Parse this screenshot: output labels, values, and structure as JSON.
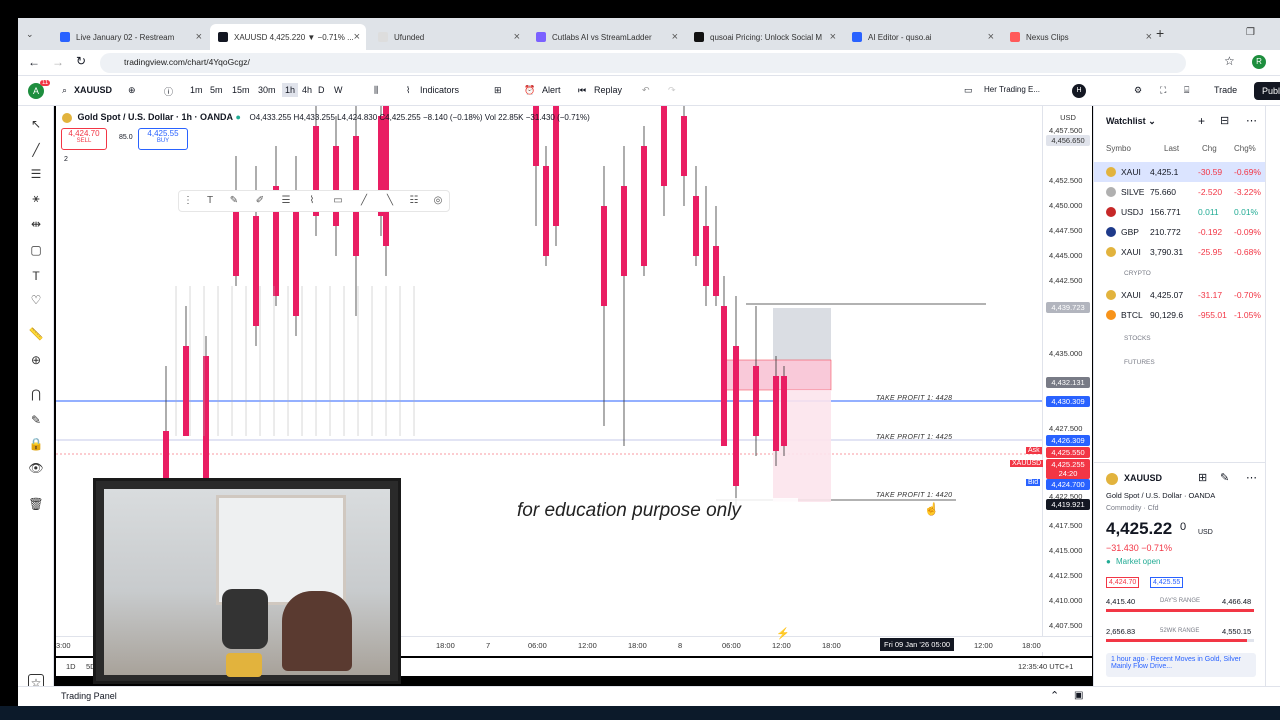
{
  "tabs": [
    {
      "label": "Live January 02 - Restream",
      "fav": "#2962ff",
      "active": false
    },
    {
      "label": "XAUUSD 4,425.220 ▼ −0.71% ...",
      "fav": "#131722",
      "active": true
    },
    {
      "label": "Ufunded",
      "fav": "#ddd",
      "active": false
    },
    {
      "label": "Cutlabs AI vs StreamLadder",
      "fav": "#7b61ff",
      "active": false
    },
    {
      "label": "qusoai Pricing: Unlock Social M",
      "fav": "#111",
      "active": false
    },
    {
      "label": "AI Editor - quso.ai",
      "fav": "#2962ff",
      "active": false
    },
    {
      "label": "Nexus Clips",
      "fav": "#ff5a5a",
      "active": false
    }
  ],
  "url": "tradingview.com/chart/4YqoGcgz/",
  "toolbar": {
    "symbol": "XAUUSD",
    "intervals": [
      "1m",
      "5m",
      "15m",
      "30m",
      "1h",
      "4h",
      "D",
      "W"
    ],
    "indicators": "Indicators",
    "alert": "Alert",
    "replay": "Replay",
    "layout_name": "Her Trading E...",
    "trade": "Trade",
    "publish": "Publi",
    "avatar_letter": "A",
    "badge": "11",
    "h_badge": "H"
  },
  "legend": {
    "title": "Gold Spot / U.S. Dollar · 1h · OANDA",
    "ohlc": "O4,433.255 H4,433.255 L4,424.830 C4,425.255 −8.140 (−0.18%) Vol 22.85K −31.430 (−0.71%)",
    "sell_price": "4,424.70",
    "sell_label": "SELL",
    "spread": "85.0",
    "buy_price": "4,425.55",
    "buy_label": "BUY",
    "count": "2"
  },
  "price_ticks": [
    "4,457.500",
    "4,452.500",
    "4,450.000",
    "4,447.500",
    "4,445.000",
    "4,442.500",
    "4,437.500",
    "4,435.000",
    "4,427.500",
    "4,422.500",
    "4,417.500",
    "4,415.000",
    "4,412.500",
    "4,410.000",
    "4,407.500"
  ],
  "price_labels": [
    {
      "text": "USD",
      "color": "#ffffff",
      "fg": "#333"
    },
    {
      "text": "4,456.650",
      "color": "#e0e3eb",
      "fg": "#333"
    },
    {
      "text": "4,439.723",
      "color": "#b2b5be",
      "fg": "#fff"
    },
    {
      "text": "4,432.131",
      "color": "#787b86",
      "fg": "#fff"
    },
    {
      "text": "4,430.309",
      "color": "#2962ff",
      "fg": "#fff"
    },
    {
      "text": "4,426.309",
      "color": "#2962ff",
      "fg": "#fff"
    },
    {
      "text": "4,425.550",
      "color": "#f23645",
      "fg": "#fff"
    },
    {
      "text": "4,425.255",
      "color": "#f23645",
      "fg": "#fff"
    },
    {
      "text": "24:20",
      "color": "#f23645",
      "fg": "#fff"
    },
    {
      "text": "4,424.700",
      "color": "#2962ff",
      "fg": "#fff"
    },
    {
      "text": "4,419.921",
      "color": "#131722",
      "fg": "#fff"
    }
  ],
  "ask_label": "Ask",
  "sym_label": "XAUUSD",
  "bid_label": "Bid",
  "take_profits": [
    "TAKE PROFIT 1: 4428",
    "TAKE PROFIT 1: 4425",
    "TAKE PROFIT 1: 4420"
  ],
  "time_ticks": [
    "3:00",
    "18:00",
    "7",
    "06:00",
    "12:00",
    "18:00",
    "8",
    "06:00",
    "12:00",
    "18:00",
    "12:00",
    "18:00"
  ],
  "time_cursor": "Fri 09 Jan '26  05:00",
  "ranges": [
    "1D",
    "5D",
    "1M",
    "3M",
    "6M",
    "YTD",
    "1Y",
    "5Y",
    "All"
  ],
  "clock": "12:35:40 UTC+1",
  "caption": "for education purpose only",
  "trading_panel": "Trading Panel",
  "watchlist": {
    "title": "Watchlist",
    "cols": [
      "Symbo",
      "Last",
      "Chg",
      "Chg%"
    ],
    "rows": [
      {
        "sym": "XAUI",
        "last": "4,425.1",
        "chg": "-30.59",
        "pct": "-0.69%",
        "dir": "neg",
        "color": "#e2b33d"
      },
      {
        "sym": "SILVE",
        "last": "75.660",
        "chg": "-2.520",
        "pct": "-3.22%",
        "dir": "neg",
        "color": "#b0b0b0"
      },
      {
        "sym": "USDJ",
        "last": "156.771",
        "chg": "0.011",
        "pct": "0.01%",
        "dir": "pos",
        "color": "#c62828"
      },
      {
        "sym": "GBP",
        "last": "210.772",
        "chg": "-0.192",
        "pct": "-0.09%",
        "dir": "neg",
        "color": "#1e3a8a"
      },
      {
        "sym": "XAUI",
        "last": "3,790.31",
        "chg": "-25.95",
        "pct": "-0.68%",
        "dir": "neg",
        "color": "#e2b33d"
      }
    ],
    "section_crypto": "CRYPTO",
    "crypto_rows": [
      {
        "sym": "XAUI",
        "last": "4,425.07",
        "chg": "-31.17",
        "pct": "-0.70%",
        "dir": "neg",
        "color": "#e2b33d"
      },
      {
        "sym": "BTCL",
        "last": "90,129.6",
        "chg": "-955.01",
        "pct": "-1.05%",
        "dir": "neg",
        "color": "#f7931a"
      }
    ],
    "section_stocks": "STOCKS",
    "section_futures": "FUTURES"
  },
  "details": {
    "symbol": "XAUUSD",
    "name": "Gold Spot / U.S. Dollar · OANDA",
    "category": "Commodity · Cfd",
    "price": "4,425.22",
    "price_small": "0",
    "currency": "USD",
    "change": "−31.430 −0.71%",
    "status": "Market open",
    "bid": "4,424.70",
    "ask": "4,425.55",
    "day_low": "4,415.40",
    "day_label": "DAY'S RANGE",
    "day_high": "4,466.48",
    "wk_low": "2,656.83",
    "wk_label": "52WK RANGE",
    "wk_high": "4,550.15",
    "news": "1 hour ago · Recent Moves in Gold, Silver Mainly Flow Drive..."
  },
  "chart_data": {
    "type": "candlestick",
    "symbol": "XAUUSD",
    "interval": "1h",
    "last": 4425.255
  }
}
